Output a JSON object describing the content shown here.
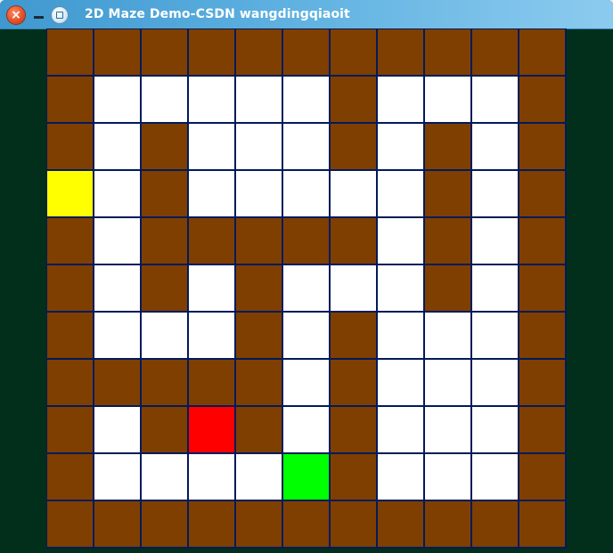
{
  "window": {
    "title": "2D Maze Demo-CSDN wangdingqiaoit",
    "buttons": {
      "close": "close-icon",
      "minimize": "minimize-icon",
      "maximize": "maximize-icon"
    }
  },
  "colors": {
    "wall": "#7f3f00",
    "path": "#ffffff",
    "player": "#ffff00",
    "marker_red": "#ff0000",
    "goal": "#00ff00",
    "grid_line": "#011a5a",
    "background": "#012f1b"
  },
  "maze": {
    "rows": 11,
    "cols": 11,
    "legend": {
      "W": "wall",
      "P": "path",
      "Y": "player",
      "R": "marker_red",
      "G": "goal"
    },
    "grid": [
      "WWWWWWWWWWW",
      "WPPPPPWPPPW",
      "WPWPPPWPWPW",
      "YPWPPPPPWPW",
      "WPWWWWWPWPW",
      "WPWPWPPPWPW",
      "WPPPWPWPPPW",
      "WWWWWPWPPPW",
      "WPWRWPWPPPW",
      "WPPPPGWPPPW",
      "WWWWWWWWWWW"
    ]
  }
}
